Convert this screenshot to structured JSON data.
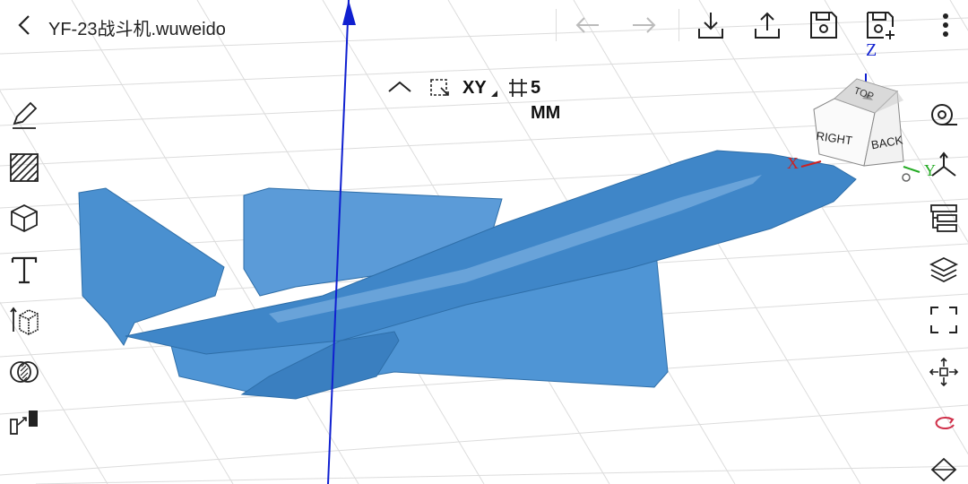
{
  "header": {
    "title": "YF-23战斗机.wuweido",
    "actions": [
      "undo",
      "redo",
      "import",
      "export",
      "save",
      "save-as"
    ],
    "more_icon": "more-vertical-icon"
  },
  "snap_bar": {
    "collapse_icon": "chevron-up-icon",
    "selection_icon": "selection-box-icon",
    "plane_label": "XY",
    "grid_icon": "grid-size-icon",
    "grid_label": "5 MM"
  },
  "view_cube": {
    "top": "TOP",
    "right": "RIGHT",
    "back": "BACK"
  },
  "axes": {
    "x": "X",
    "y": "Y",
    "z": "Z"
  },
  "left_tools": [
    "sketch-pencil-icon",
    "hatch-icon",
    "cube-icon",
    "text-icon",
    "extrude-icon",
    "boolean-icon",
    "transform-icon"
  ],
  "right_tools": [
    "tape-measure-icon",
    "axis-icon",
    "feature-tree-icon",
    "layers-icon",
    "fit-view-icon",
    "move-icon",
    "rotate-icon",
    "mirror-icon"
  ],
  "colors": {
    "model": "#4a90d0",
    "model_dark": "#2e6ea8",
    "z_axis": "#1020d0",
    "x_axis": "#cc2222",
    "y_axis": "#22aa22",
    "grid": "#d9d9d9",
    "accent": "#d0304a"
  }
}
